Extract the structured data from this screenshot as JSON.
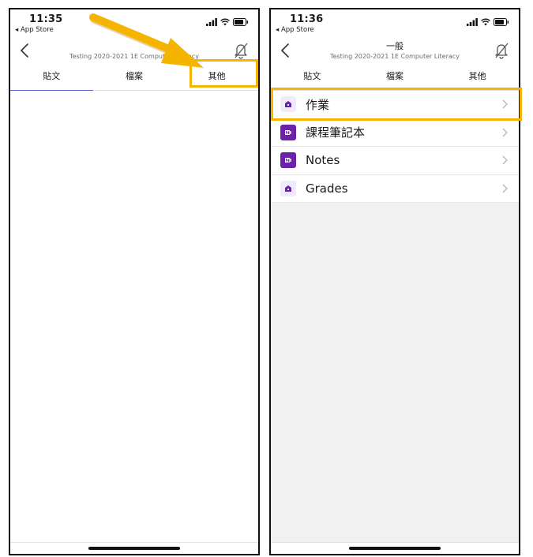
{
  "left_screen": {
    "time": "11:35",
    "back_app": "◂ App Store",
    "title": "",
    "subtitle": "Testing 2020-2021 1E Computer Literacy",
    "tabs": [
      {
        "label": "貼文",
        "active": true
      },
      {
        "label": "檔案",
        "active": false
      },
      {
        "label": "其他",
        "active": false
      }
    ]
  },
  "right_screen": {
    "time": "11:36",
    "back_app": "◂ App Store",
    "title": "一般",
    "subtitle": "Testing 2020-2021 1E Computer Literacy",
    "tabs": [
      {
        "label": "貼文",
        "active": false
      },
      {
        "label": "檔案",
        "active": false
      },
      {
        "label": "其他",
        "active": false
      }
    ],
    "items": [
      {
        "label": "作業",
        "icon": "assignments-icon"
      },
      {
        "label": "課程筆記本",
        "icon": "onenote-icon"
      },
      {
        "label": "Notes",
        "icon": "onenote-icon"
      },
      {
        "label": "Grades",
        "icon": "grades-icon"
      }
    ]
  },
  "colors": {
    "highlight": "#f4b400",
    "tab_indicator": "#5b5fc7",
    "teams_purple": "#6b21a8"
  }
}
